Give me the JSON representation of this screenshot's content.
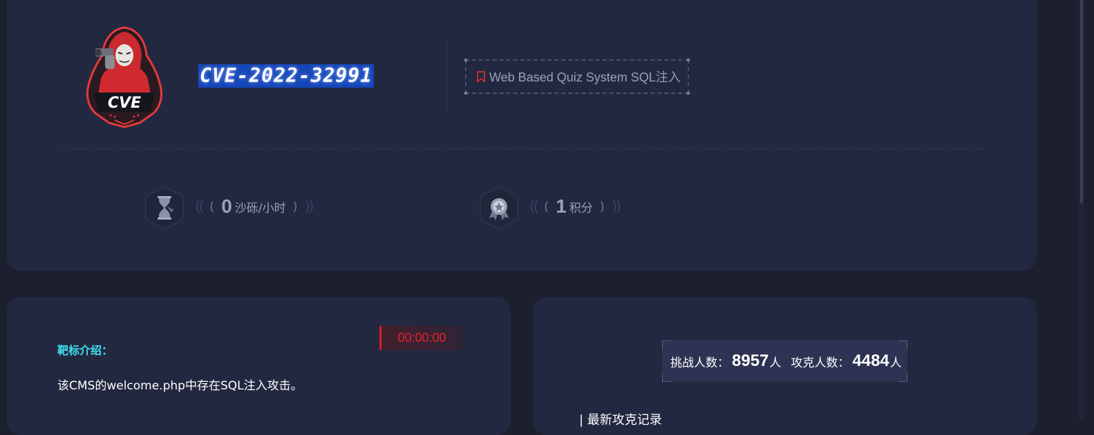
{
  "header": {
    "title": "CVE-2022-32991",
    "logo_text": "CVE",
    "tag_label": "Web Based Quiz System SQL注入",
    "tag_icon": "bookmark-icon"
  },
  "stats": {
    "sand": {
      "value": "0",
      "unit": "沙砾/小时",
      "icon": "hourglass-icon"
    },
    "points": {
      "value": "1",
      "unit": "积分",
      "icon": "medal-icon"
    }
  },
  "target": {
    "timer": "00:00:00",
    "intro_title": "靶标介绍：",
    "intro_text": "该CMS的welcome.php中存在SQL注入攻击。"
  },
  "challenge": {
    "challengers_label": "挑战人数：",
    "challengers_value": "8957",
    "challengers_unit": "人",
    "solvers_label": "攻克人数：",
    "solvers_value": "4484",
    "solvers_unit": "人",
    "latest_title": "| 最新攻克记录"
  },
  "colors": {
    "background": "#1b1f2e",
    "card": "#232841",
    "accent_red": "#e2232d",
    "accent_cyan": "#3fe0ef",
    "title_highlight": "#1546b8"
  }
}
